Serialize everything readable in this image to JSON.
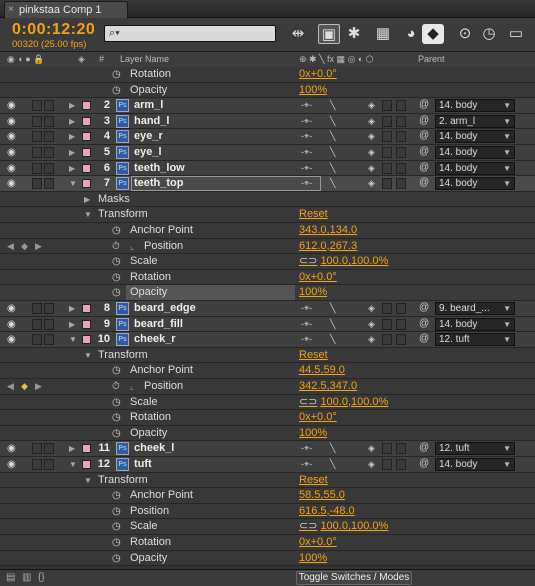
{
  "tab": {
    "title": "pinkstaa Comp 1",
    "close": "×"
  },
  "toolbar": {
    "timecode": "0:00:12:20",
    "frames": "00320 (25.00 fps)",
    "search_icon": "search-icon"
  },
  "columns": {
    "layer_name": "Layer Name",
    "hash": "#",
    "parent": "Parent"
  },
  "rows": [
    {
      "kind": "prop",
      "indent": 2,
      "name": "Rotation",
      "value": "0x+0.0°"
    },
    {
      "kind": "prop",
      "indent": 2,
      "name": "Opacity",
      "value": "100%"
    },
    {
      "kind": "layer",
      "num": "2",
      "name": "arm_l",
      "parent": "14. body"
    },
    {
      "kind": "layer",
      "num": "3",
      "name": "hand_l",
      "parent": "2. arm_l"
    },
    {
      "kind": "layer",
      "num": "4",
      "name": "eye_r",
      "parent": "14. body"
    },
    {
      "kind": "layer",
      "num": "5",
      "name": "eye_l",
      "parent": "14. body"
    },
    {
      "kind": "layer",
      "num": "6",
      "name": "teeth_low",
      "parent": "14. body"
    },
    {
      "kind": "layer",
      "num": "7",
      "name": "teeth_top",
      "parent": "14. body",
      "expanded": true,
      "selected": true
    },
    {
      "kind": "group",
      "indent": 1,
      "name": "Masks",
      "value": ""
    },
    {
      "kind": "group",
      "indent": 1,
      "name": "Transform",
      "value": "Reset",
      "expanded": true
    },
    {
      "kind": "prop",
      "indent": 2,
      "name": "Anchor Point",
      "value": "343.0,134.0"
    },
    {
      "kind": "prop",
      "indent": 2,
      "name": "Position",
      "value": "612.0,267.3",
      "keyed": true
    },
    {
      "kind": "prop",
      "indent": 2,
      "name": "Scale",
      "value": "100.0,100.0%",
      "chain": true
    },
    {
      "kind": "prop",
      "indent": 2,
      "name": "Rotation",
      "value": "0x+0.0°"
    },
    {
      "kind": "prop",
      "indent": 2,
      "name": "Opacity",
      "value": "100%",
      "highlight": true
    },
    {
      "kind": "layer",
      "num": "8",
      "name": "beard_edge",
      "parent": "9. beard_..."
    },
    {
      "kind": "layer",
      "num": "9",
      "name": "beard_fill",
      "parent": "14. body"
    },
    {
      "kind": "layer",
      "num": "10",
      "name": "cheek_r",
      "parent": "12. tuft",
      "expanded": true
    },
    {
      "kind": "group",
      "indent": 1,
      "name": "Transform",
      "value": "Reset",
      "expanded": true
    },
    {
      "kind": "prop",
      "indent": 2,
      "name": "Anchor Point",
      "value": "44.5,59.0"
    },
    {
      "kind": "prop",
      "indent": 2,
      "name": "Position",
      "value": "342.5,347.0",
      "keyed": true,
      "goldkey": true
    },
    {
      "kind": "prop",
      "indent": 2,
      "name": "Scale",
      "value": "100.0,100.0%",
      "chain": true
    },
    {
      "kind": "prop",
      "indent": 2,
      "name": "Rotation",
      "value": "0x+0.0°"
    },
    {
      "kind": "prop",
      "indent": 2,
      "name": "Opacity",
      "value": "100%"
    },
    {
      "kind": "layer",
      "num": "11",
      "name": "cheek_l",
      "parent": "12. tuft"
    },
    {
      "kind": "layer",
      "num": "12",
      "name": "tuft",
      "parent": "14. body",
      "expanded": true
    },
    {
      "kind": "group",
      "indent": 1,
      "name": "Transform",
      "value": "Reset",
      "expanded": true
    },
    {
      "kind": "prop",
      "indent": 2,
      "name": "Anchor Point",
      "value": "58.5,55.0"
    },
    {
      "kind": "prop",
      "indent": 2,
      "name": "Position",
      "value": "616.5,-48.0"
    },
    {
      "kind": "prop",
      "indent": 2,
      "name": "Scale",
      "value": "100.0,100.0%",
      "chain": true
    },
    {
      "kind": "prop",
      "indent": 2,
      "name": "Rotation",
      "value": "0x+0.0°"
    },
    {
      "kind": "prop",
      "indent": 2,
      "name": "Opacity",
      "value": "100%"
    }
  ],
  "footer": {
    "toggle": "Toggle Switches / Modes"
  },
  "colors": {
    "accent": "#f2a310",
    "label_pink": "#e8a4b8"
  }
}
